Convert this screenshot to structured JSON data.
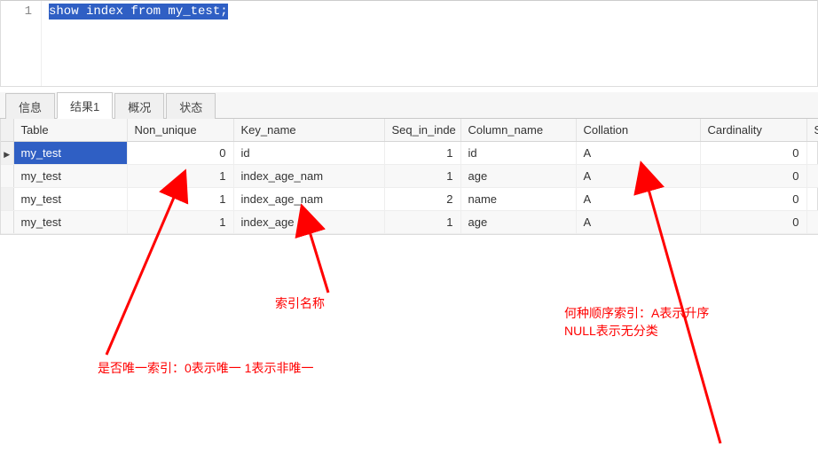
{
  "editor": {
    "line_number": "1",
    "sql": "show index from my_test;"
  },
  "tabs": {
    "info": "信息",
    "result1": "结果1",
    "profile": "概况",
    "status": "状态"
  },
  "grid": {
    "headers": {
      "table": "Table",
      "non_unique": "Non_unique",
      "key_name": "Key_name",
      "seq_in_inde": "Seq_in_inde",
      "column_name": "Column_name",
      "collation": "Collation",
      "cardinality": "Cardinality",
      "extra": "S"
    },
    "rows": [
      {
        "table": "my_test",
        "non_unique": "0",
        "key_name": "id",
        "seq": "1",
        "column_name": "id",
        "collation": "A",
        "cardinality": "0"
      },
      {
        "table": "my_test",
        "non_unique": "1",
        "key_name": "index_age_nam",
        "seq": "1",
        "column_name": "age",
        "collation": "A",
        "cardinality": "0"
      },
      {
        "table": "my_test",
        "non_unique": "1",
        "key_name": "index_age_nam",
        "seq": "2",
        "column_name": "name",
        "collation": "A",
        "cardinality": "0"
      },
      {
        "table": "my_test",
        "non_unique": "1",
        "key_name": "index_age",
        "seq": "1",
        "column_name": "age",
        "collation": "A",
        "cardinality": "0"
      }
    ]
  },
  "annotations": {
    "non_unique_note": "是否唯一索引：0表示唯一 1表示非唯一",
    "key_name_note": "索引名称",
    "collation_note_line1": "何种顺序索引：A表示升序",
    "collation_note_line2": "NULL表示无分类"
  }
}
